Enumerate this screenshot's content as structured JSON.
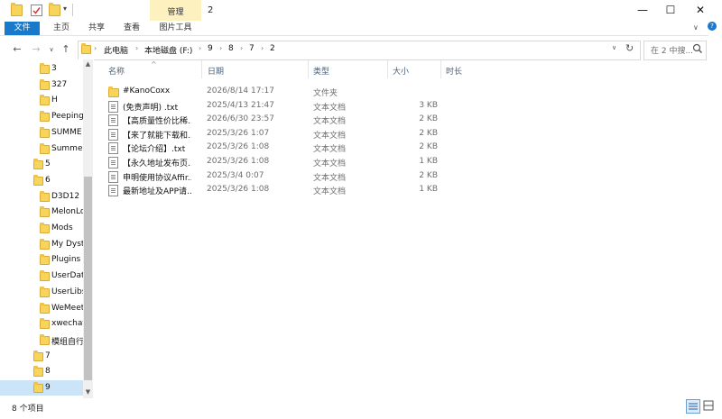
{
  "window": {
    "title": "2",
    "context_tab": "管理",
    "controls": {
      "minimize": "—",
      "maximize": "☐",
      "close": "✕"
    }
  },
  "ribbon": {
    "tabs": [
      "文件",
      "主页",
      "共享",
      "查看",
      "图片工具"
    ]
  },
  "nav": {
    "back": "←",
    "forward": "→",
    "recent": "∨",
    "up": "↑",
    "refresh": "↻",
    "dropdown": "∨"
  },
  "address": {
    "crumbs": [
      "此电脑",
      "本地磁盘 (F:)",
      "9",
      "8",
      "7",
      "2"
    ]
  },
  "search": {
    "placeholder": "在 2 中搜..."
  },
  "nav_pane": {
    "items": [
      {
        "label": "3"
      },
      {
        "label": "327"
      },
      {
        "label": "H"
      },
      {
        "label": "Peeping"
      },
      {
        "label": "SUMME"
      },
      {
        "label": "Summer"
      },
      {
        "label": "5"
      },
      {
        "label": "6"
      },
      {
        "label": "D3D12"
      },
      {
        "label": "MelonLo"
      },
      {
        "label": "Mods"
      },
      {
        "label": "My Dyst"
      },
      {
        "label": "Plugins"
      },
      {
        "label": "UserDat"
      },
      {
        "label": "UserLibs"
      },
      {
        "label": "WeMeet"
      },
      {
        "label": "xwechat"
      },
      {
        "label": "模组自行"
      },
      {
        "label": "7"
      },
      {
        "label": "8"
      },
      {
        "label": "9"
      }
    ]
  },
  "columns": {
    "name": "名称",
    "date": "日期",
    "type": "类型",
    "size": "大小",
    "length": "时长"
  },
  "files": [
    {
      "name": "#KanoCoxx",
      "date": "2026/8/14 17:17",
      "type": "文件夹",
      "size": "",
      "icon": "folder-icon"
    },
    {
      "name": "(免责声明) .txt",
      "date": "2025/4/13 21:47",
      "type": "文本文档",
      "size": "3 KB",
      "icon": "text-file-icon"
    },
    {
      "name": "【高质量性价比稀...",
      "date": "2026/6/30 23:57",
      "type": "文本文档",
      "size": "2 KB",
      "icon": "text-file-icon"
    },
    {
      "name": "【来了就能下载和...",
      "date": "2025/3/26 1:07",
      "type": "文本文档",
      "size": "2 KB",
      "icon": "text-file-icon"
    },
    {
      "name": "【论坛介绍】.txt",
      "date": "2025/3/26 1:08",
      "type": "文本文档",
      "size": "2 KB",
      "icon": "text-file-icon"
    },
    {
      "name": "【永久地址发布页...",
      "date": "2025/3/26 1:08",
      "type": "文本文档",
      "size": "1 KB",
      "icon": "text-file-icon"
    },
    {
      "name": "申明使用协议Affir...",
      "date": "2025/3/4 0:07",
      "type": "文本文档",
      "size": "2 KB",
      "icon": "text-file-icon"
    },
    {
      "name": "最新地址及APP请...",
      "date": "2025/3/26 1:08",
      "type": "文本文档",
      "size": "1 KB",
      "icon": "text-file-icon"
    }
  ],
  "status": {
    "count": "8 个项目"
  },
  "colors": {
    "file_tab": "#1979ca",
    "context_tab": "#fdf1c0",
    "folder": "#f7d45a"
  }
}
